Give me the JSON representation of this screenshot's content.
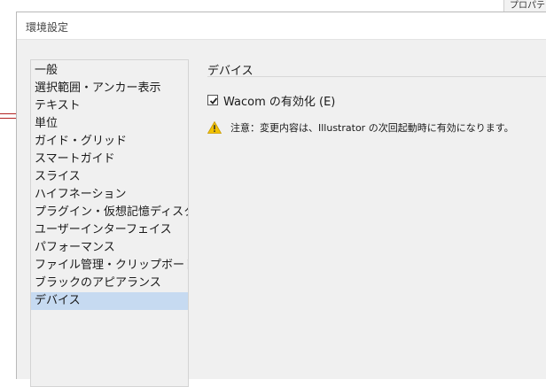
{
  "background": {
    "tab_label": "プロパテ"
  },
  "dialog": {
    "title": "環境設定"
  },
  "sidebar": {
    "items": [
      {
        "label": "一般"
      },
      {
        "label": "選択範囲・アンカー表示"
      },
      {
        "label": "テキスト"
      },
      {
        "label": "単位"
      },
      {
        "label": "ガイド・グリッド"
      },
      {
        "label": "スマートガイド"
      },
      {
        "label": "スライス"
      },
      {
        "label": "ハイフネーション"
      },
      {
        "label": "プラグイン・仮想記憶ディスク"
      },
      {
        "label": "ユーザーインターフェイス"
      },
      {
        "label": "パフォーマンス"
      },
      {
        "label": "ファイル管理・クリップボード"
      },
      {
        "label": "ブラックのアピアランス"
      },
      {
        "label": "デバイス"
      }
    ],
    "selected_index": 13
  },
  "panel": {
    "title": "デバイス",
    "wacom_checkbox": {
      "label": "Wacom の有効化 (E)",
      "checked": true
    },
    "note": "注意：変更内容は、Illustrator の次回起動時に有効になります。"
  },
  "colors": {
    "selected_bg": "#c6daf1",
    "warning": "#f2c200"
  }
}
